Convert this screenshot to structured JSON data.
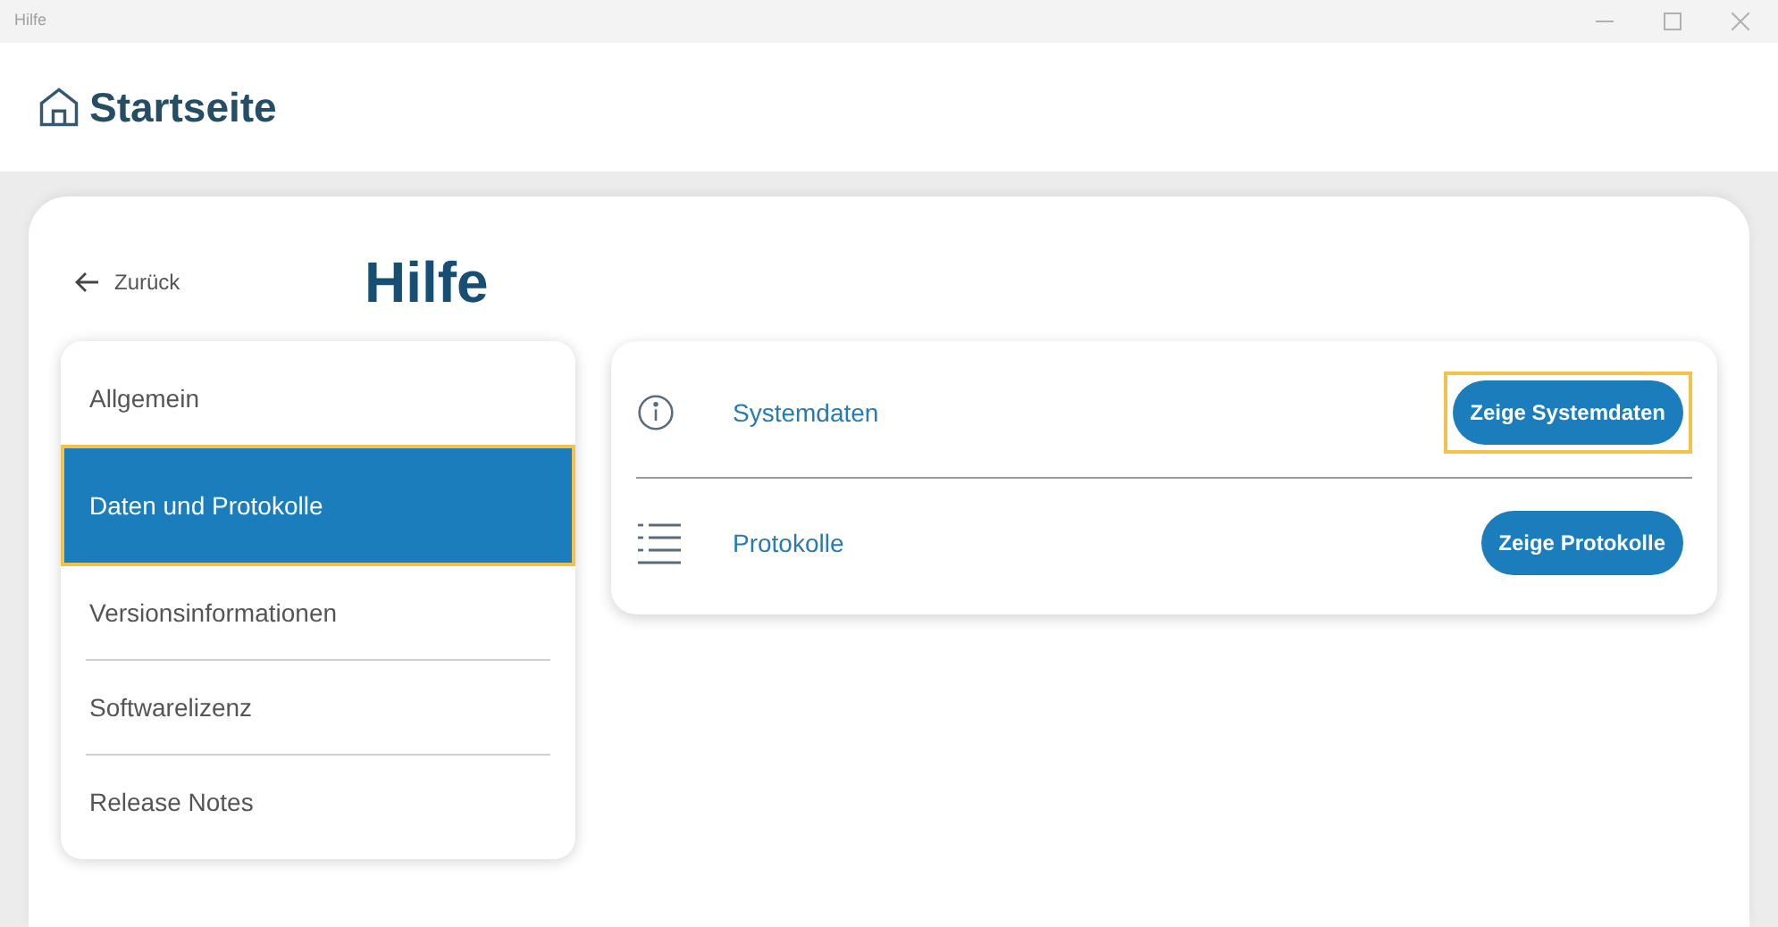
{
  "window": {
    "title": "Hilfe"
  },
  "header": {
    "title": "Startseite"
  },
  "back": {
    "label": "Zurück"
  },
  "page_title": "Hilfe",
  "sidebar": {
    "items": [
      {
        "label": "Allgemein",
        "selected": false
      },
      {
        "label": "Daten und Protokolle",
        "selected": true
      },
      {
        "label": "Versionsinformationen",
        "selected": false
      },
      {
        "label": "Softwarelizenz",
        "selected": false
      },
      {
        "label": "Release Notes",
        "selected": false
      }
    ]
  },
  "rows": [
    {
      "kind": "info",
      "label": "Systemdaten",
      "button": "Zeige Systemdaten",
      "focused": true
    },
    {
      "kind": "list",
      "label": "Protokolle",
      "button": "Zeige Protokolle",
      "focused": false
    }
  ]
}
